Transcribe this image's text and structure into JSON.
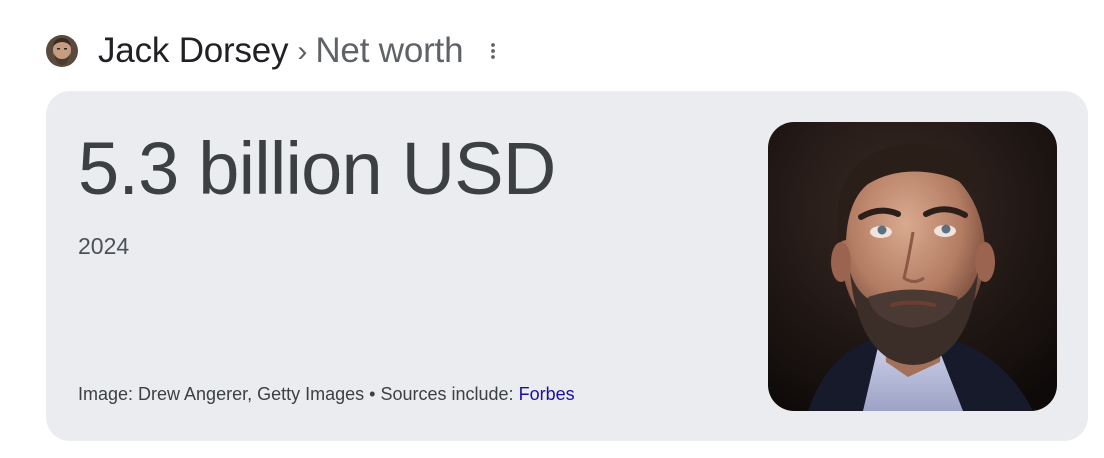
{
  "header": {
    "avatar_icon": "person-avatar-icon",
    "entity": "Jack Dorsey",
    "separator": "›",
    "attribute": "Net worth",
    "more_icon": "more-vertical-icon"
  },
  "card": {
    "value": "5.3 billion USD",
    "year": "2024",
    "image_credit": "Image: Drew Angerer, Getty Images",
    "bullet": "•",
    "sources_label": "Sources include:",
    "source_link": "Forbes",
    "photo_icon": "portrait-photo"
  },
  "colors": {
    "card_background": "#ebecef",
    "link": "#1a0dab",
    "muted_text": "#5f6368"
  }
}
